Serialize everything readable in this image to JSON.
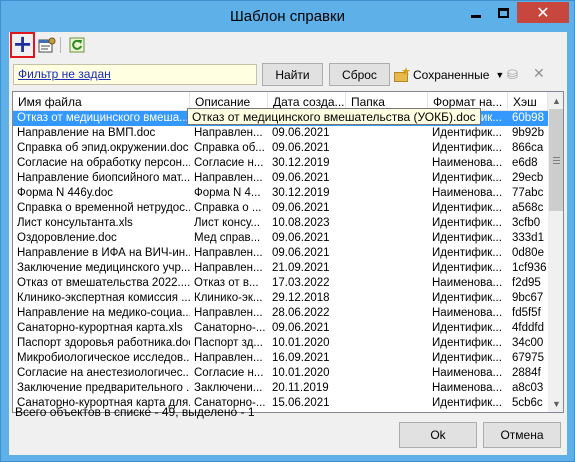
{
  "window": {
    "title": "Шаблон справки"
  },
  "filter": {
    "label": "Фильтр не задан",
    "find_label": "Найти",
    "reset_label": "Сброс",
    "saved_label": "Сохраненные"
  },
  "tooltip": {
    "text": "Отказ от медицинского вмешательства (УОКБ).doc"
  },
  "grid": {
    "columns": [
      "Имя файла",
      "Описание",
      "Дата созда...",
      "Папка",
      "Формат на...",
      "Хэш"
    ],
    "rows": [
      [
        "Отказ от медицинского вмеша...",
        "Отказ от м...",
        "09.06.2021",
        "",
        "Идентифик...",
        "60b98"
      ],
      [
        "Направление на ВМП.doc",
        "Направлен...",
        "09.06.2021",
        "",
        "Идентифик...",
        "9b92b"
      ],
      [
        "Справка об эпид.окружении.doc",
        "Справка об...",
        "09.06.2021",
        "",
        "Идентифик...",
        "866ca"
      ],
      [
        "Согласие на обработку персон...",
        "Согласие н...",
        "30.12.2019",
        "",
        "Наименова...",
        "e6d8"
      ],
      [
        "Направление биопсийного мат...",
        "Направлен...",
        "09.06.2021",
        "",
        "Идентифик...",
        "29ecb"
      ],
      [
        "Форма N 446у.doc",
        "Форма N 4...",
        "30.12.2019",
        "",
        "Наименова...",
        "77abc"
      ],
      [
        "Справка о временной нетрудос...",
        "Справка о ...",
        "09.06.2021",
        "",
        "Идентифик...",
        "a568c"
      ],
      [
        "Лист консультанта.xls",
        "Лист консу...",
        "10.08.2023",
        "",
        "Идентифик...",
        "3cfb0"
      ],
      [
        "Оздоровление.doc",
        "Мед справ...",
        "09.06.2021",
        "",
        "Идентифик...",
        "333d1"
      ],
      [
        "Направление в ИФА на ВИЧ-ин...",
        "Направлен...",
        "09.06.2021",
        "",
        "Идентифик...",
        "0d80e"
      ],
      [
        "Заключение медицинского учр...",
        "Направлен...",
        "21.09.2021",
        "",
        "Идентифик...",
        "1cf936"
      ],
      [
        "Отказ от вмешательства 2022....",
        "Отказ от в...",
        "17.03.2022",
        "",
        "Наименова...",
        "f2d95"
      ],
      [
        "Клинико-экспертная комиссия ...",
        "Клинико-эк...",
        "29.12.2018",
        "",
        "Идентифик...",
        "9bc67"
      ],
      [
        "Направление на медико-социа...",
        "Направлен...",
        "28.06.2022",
        "",
        "Наименова...",
        "fd5f5f"
      ],
      [
        "Санаторно-курортная карта.xls",
        "Санаторно-...",
        "09.06.2021",
        "",
        "Идентифик...",
        "4fddfd"
      ],
      [
        "Паспорт здоровья работника.doc",
        "Паспорт зд...",
        "10.01.2020",
        "",
        "Идентифик...",
        "34c00"
      ],
      [
        "Микробиологическое исследов...",
        "Направлен...",
        "16.09.2021",
        "",
        "Идентифик...",
        "67975"
      ],
      [
        "Согласие на анестезиологичес...",
        "Согласие н...",
        "10.01.2020",
        "",
        "Наименова...",
        "2884f"
      ],
      [
        "Заключение предварительного ...",
        "Заключени...",
        "20.11.2019",
        "",
        "Наименова...",
        "a8c03"
      ],
      [
        "Санаторно-курортная карта для...",
        "Санаторно-...",
        "15.06.2021",
        "",
        "Идентифик...",
        "5cb6c"
      ]
    ]
  },
  "status": {
    "text": "Всего объектов в списке - 49, выделено - 1"
  },
  "buttons": {
    "ok_label": "Ok",
    "cancel_label": "Отмена"
  },
  "icons": {
    "add": "plus-icon",
    "properties": "properties-icon",
    "refresh": "refresh-icon",
    "saved": "saved-folder-icon"
  },
  "colors": {
    "title_bar": "#5eb1e8",
    "selection": "#3399ff",
    "close_button": "#c7463e",
    "highlight_frame": "#e0161d"
  }
}
